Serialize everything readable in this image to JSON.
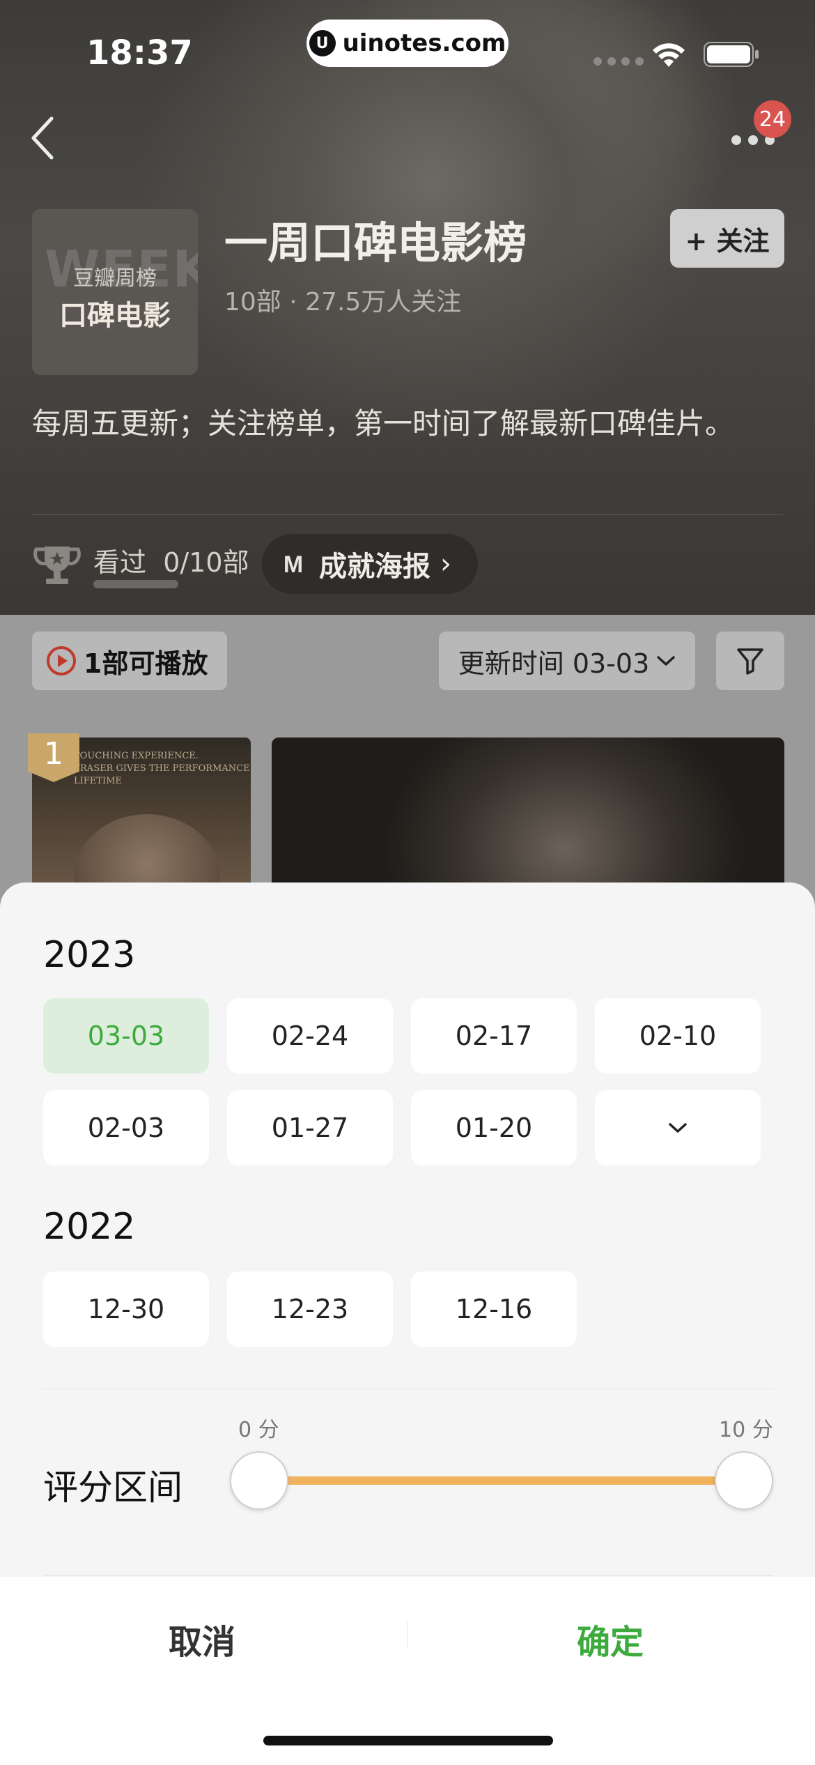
{
  "status_bar": {
    "time": "18:37",
    "url": "uinotes.com"
  },
  "header": {
    "notification_count": "24",
    "cover_watermark": "WEEK",
    "cover_top": "豆瓣周榜",
    "cover_bottom": "口碑电影",
    "title": "一周口碑电影榜",
    "meta": "10部 · 27.5万人关注",
    "follow_label": "+ 关注",
    "description": "每周五更新；关注榜单，第一时间了解最新口碑佳片。",
    "watched_prefix": "看过",
    "watched_value": "0/10部",
    "poster_label": "成就海报",
    "poster_logo_letter": "M"
  },
  "toolbar": {
    "playable_label": "1部可播放",
    "update_label": "更新时间 03-03"
  },
  "movie_card": {
    "rank": "1",
    "thumb_caption": "TOUCHING EXPERIENCE.\nFRASER GIVES THE PERFORMANCE\nLIFETIME"
  },
  "sheet": {
    "years": [
      {
        "year": "2023",
        "dates": [
          "03-03",
          "02-24",
          "02-17",
          "02-10",
          "02-03",
          "01-27",
          "01-20"
        ],
        "selected": "03-03",
        "has_more": true
      },
      {
        "year": "2022",
        "dates": [
          "12-30",
          "12-23",
          "12-16"
        ]
      }
    ],
    "rating_label": "评分区间",
    "rating_min": "0 分",
    "rating_max": "10 分",
    "rating_range": [
      0,
      10
    ],
    "cancel_label": "取消",
    "confirm_label": "确定"
  },
  "colors": {
    "accent_green": "#3daa3d",
    "slider_orange": "#f0b25c",
    "badge_red": "#d9534f"
  }
}
